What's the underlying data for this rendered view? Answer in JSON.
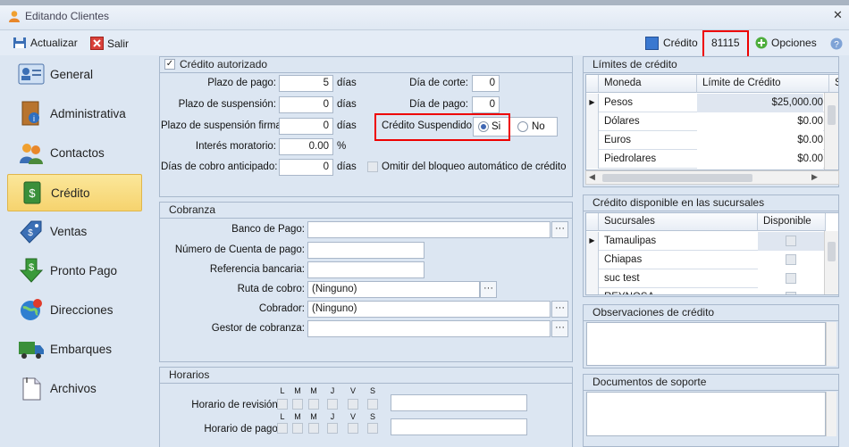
{
  "window": {
    "title": "Editando Clientes"
  },
  "toolbar": {
    "update_label": "Actualizar",
    "exit_label": "Salir",
    "credit_label": "Crédito",
    "client_number": "81115",
    "options_label": "Opciones"
  },
  "sidebar": {
    "items": [
      {
        "label": "General"
      },
      {
        "label": "Administrativa"
      },
      {
        "label": "Contactos"
      },
      {
        "label": "Crédito"
      },
      {
        "label": "Ventas"
      },
      {
        "label": "Pronto Pago"
      },
      {
        "label": "Direcciones"
      },
      {
        "label": "Embarques"
      },
      {
        "label": "Archivos"
      }
    ]
  },
  "credit": {
    "authorized_label": "Crédito autorizado",
    "payment_term_label": "Plazo de pago:",
    "payment_term": "5",
    "suspension_term_label": "Plazo de suspensión:",
    "suspension_term": "0",
    "firm_suspension_label": "Plazo de suspensión firma:",
    "firm_suspension": "0",
    "interest_label": "Interés moratorio:",
    "interest": "0.00",
    "percent": "%",
    "early_days_label": "Días de cobro anticipado:",
    "early_days": "0",
    "days_unit": "días",
    "cutoff_label": "Día de corte:",
    "cutoff": "0",
    "payday_label": "Día de pago:",
    "payday": "0",
    "suspended_label": "Crédito Suspendido:",
    "yes": "Si",
    "no": "No",
    "omit_label": "Omitir del bloqueo automático de crédito"
  },
  "collection": {
    "title": "Cobranza",
    "bank_label": "Banco de Pago:",
    "bank": "",
    "account_label": "Número de Cuenta de pago:",
    "account": "",
    "reference_label": "Referencia bancaria:",
    "reference": "",
    "route_label": "Ruta de cobro:",
    "route": "(Ninguno)",
    "collector_label": "Cobrador:",
    "collector": "(Ninguno)",
    "manager_label": "Gestor de cobranza:",
    "manager": ""
  },
  "schedule": {
    "title": "Horarios",
    "days": [
      "L",
      "M",
      "M",
      "J",
      "V",
      "S"
    ],
    "review_label": "Horario de revisión:",
    "payment_label": "Horario de pago:"
  },
  "limits": {
    "title": "Límites de crédito",
    "headers": [
      "Moneda",
      "Límite de Crédito",
      "S"
    ],
    "rows": [
      {
        "currency": "Pesos",
        "limit": "$25,000.00"
      },
      {
        "currency": "Dólares",
        "limit": "$0.00"
      },
      {
        "currency": "Euros",
        "limit": "$0.00"
      },
      {
        "currency": "Piedrolares",
        "limit": "$0.00"
      }
    ]
  },
  "branches": {
    "title": "Crédito disponible en las sucursales",
    "headers": [
      "Sucursales",
      "Disponible"
    ],
    "rows": [
      {
        "name": "Tamaulipas"
      },
      {
        "name": "Chiapas"
      },
      {
        "name": "suc test"
      },
      {
        "name": "REYNOSA"
      }
    ]
  },
  "observations": {
    "title": "Observaciones de crédito"
  },
  "documents": {
    "title": "Documentos de soporte"
  }
}
